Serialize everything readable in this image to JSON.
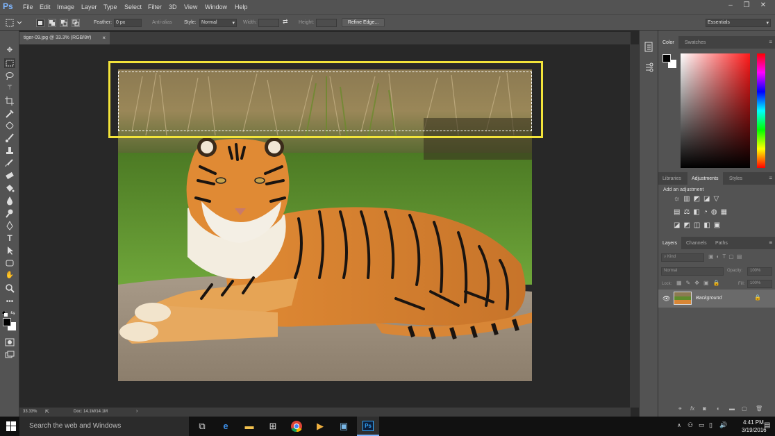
{
  "app": {
    "logo": "Ps"
  },
  "menu": [
    "File",
    "Edit",
    "Image",
    "Layer",
    "Type",
    "Select",
    "Filter",
    "3D",
    "View",
    "Window",
    "Help"
  ],
  "window_controls": {
    "minimize": "–",
    "restore": "❐",
    "close": "✕"
  },
  "options_bar": {
    "feather_label": "Feather:",
    "feather_value": "0 px",
    "antialias_label": "Anti-alias",
    "style_label": "Style:",
    "style_value": "Normal",
    "width_label": "Width:",
    "height_label": "Height:",
    "refine_edge": "Refine Edge...",
    "workspace": "Essentials"
  },
  "document": {
    "tab_title": "tiger-09.jpg @ 33.3% (RGB/8#)",
    "tab_close": "×",
    "zoom": "33.33%",
    "doc_size": "Doc: 14.1M/14.1M"
  },
  "panels": {
    "color_tabs": [
      "Color",
      "Swatches"
    ],
    "adjust_tabs": [
      "Libraries",
      "Adjustments",
      "Styles"
    ],
    "add_adjustment": "Add an adjustment",
    "layers_tabs": [
      "Layers",
      "Channels",
      "Paths"
    ],
    "kind_label": "Kind",
    "blend_mode": "Normal",
    "opacity_label": "Opacity:",
    "opacity_value": "100%",
    "lock_label": "Lock:",
    "fill_label": "Fill:",
    "fill_value": "100%",
    "layer_name": "Background"
  },
  "taskbar": {
    "search_placeholder": "Search the web and Windows",
    "time": "4:41 PM",
    "date": "3/19/2016"
  },
  "colors": {
    "highlight_box": "#f2e33a",
    "ps_blue": "#31a8ff"
  }
}
